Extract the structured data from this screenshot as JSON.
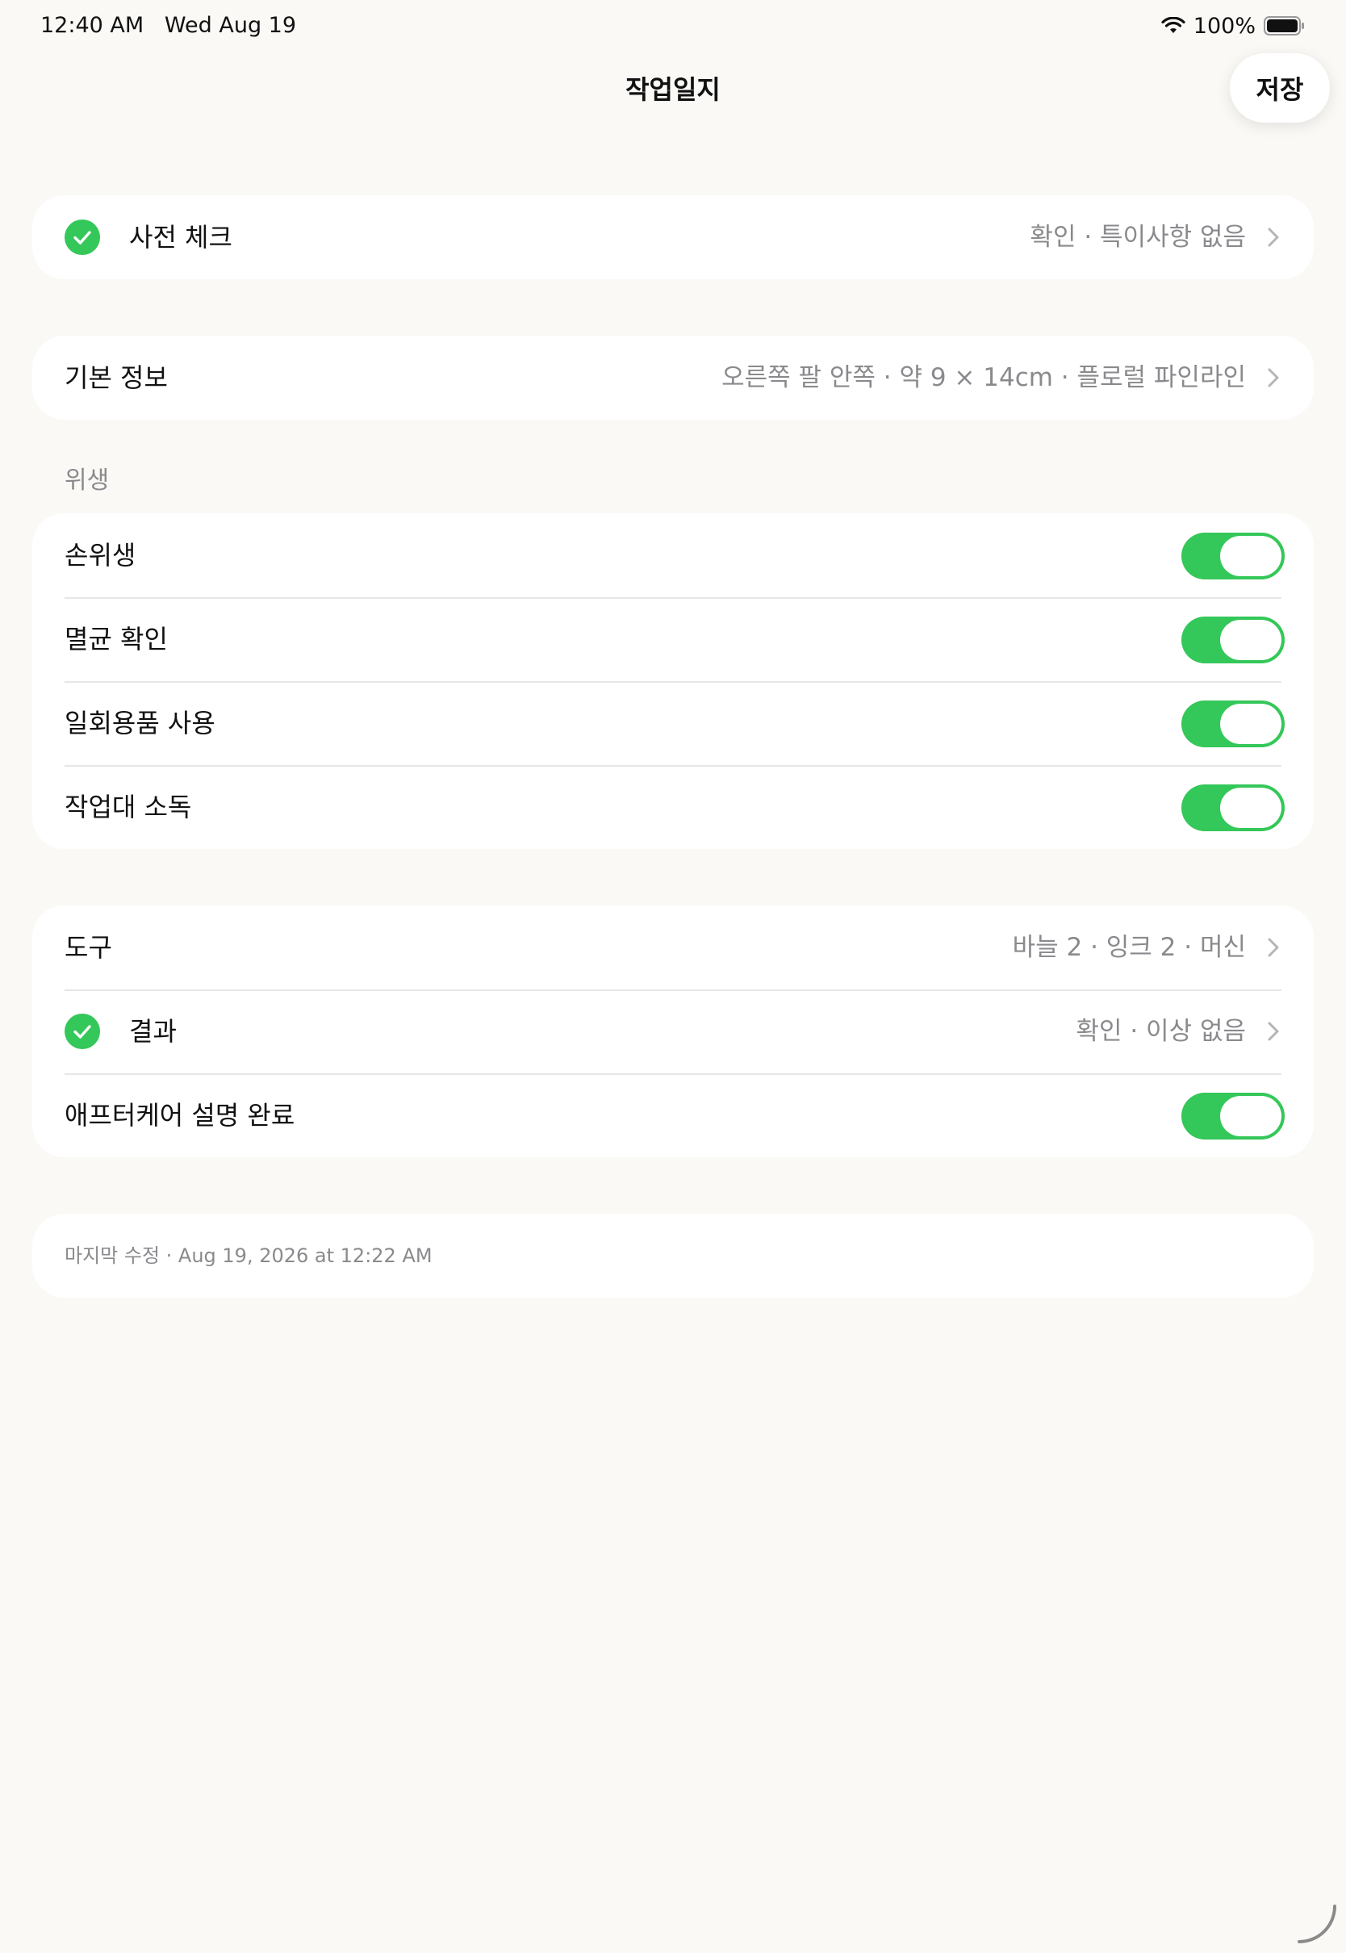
{
  "status_bar": {
    "time": "12:40 AM",
    "date": "Wed Aug 19",
    "battery": "100%",
    "wifi_icon": "wifi-icon",
    "battery_icon": "battery-full-icon"
  },
  "nav": {
    "title": "작업일지",
    "save_label": "저장"
  },
  "precheck": {
    "label": "사전 체크",
    "value": "확인 · 특이사항 없음",
    "icon": "checkmark-circle-icon",
    "checked": true
  },
  "basic_info": {
    "label": "기본 정보",
    "value": "오른쪽 팔 안쪽 · 약 9 × 14cm · 플로럴 파인라인"
  },
  "hygiene": {
    "header": "위생",
    "items": [
      {
        "label": "손위생",
        "on": true
      },
      {
        "label": "멸균 확인",
        "on": true
      },
      {
        "label": "일회용품 사용",
        "on": true
      },
      {
        "label": "작업대 소독",
        "on": true
      }
    ]
  },
  "work": {
    "tools": {
      "label": "도구",
      "value": "바늘 2 · 잉크 2 · 머신"
    },
    "result": {
      "label": "결과",
      "value": "확인 · 이상 없음",
      "icon": "checkmark-circle-icon",
      "checked": true
    },
    "aftercare": {
      "label": "애프터케어 설명 완료",
      "on": true
    }
  },
  "footer": {
    "last_modified": "마지막 수정 · Aug 19, 2026 at 12:22 AM"
  },
  "colors": {
    "background": "#faf9f6",
    "card": "#ffffff",
    "accent_green": "#34c759",
    "secondary_text": "#8a8a8e"
  }
}
